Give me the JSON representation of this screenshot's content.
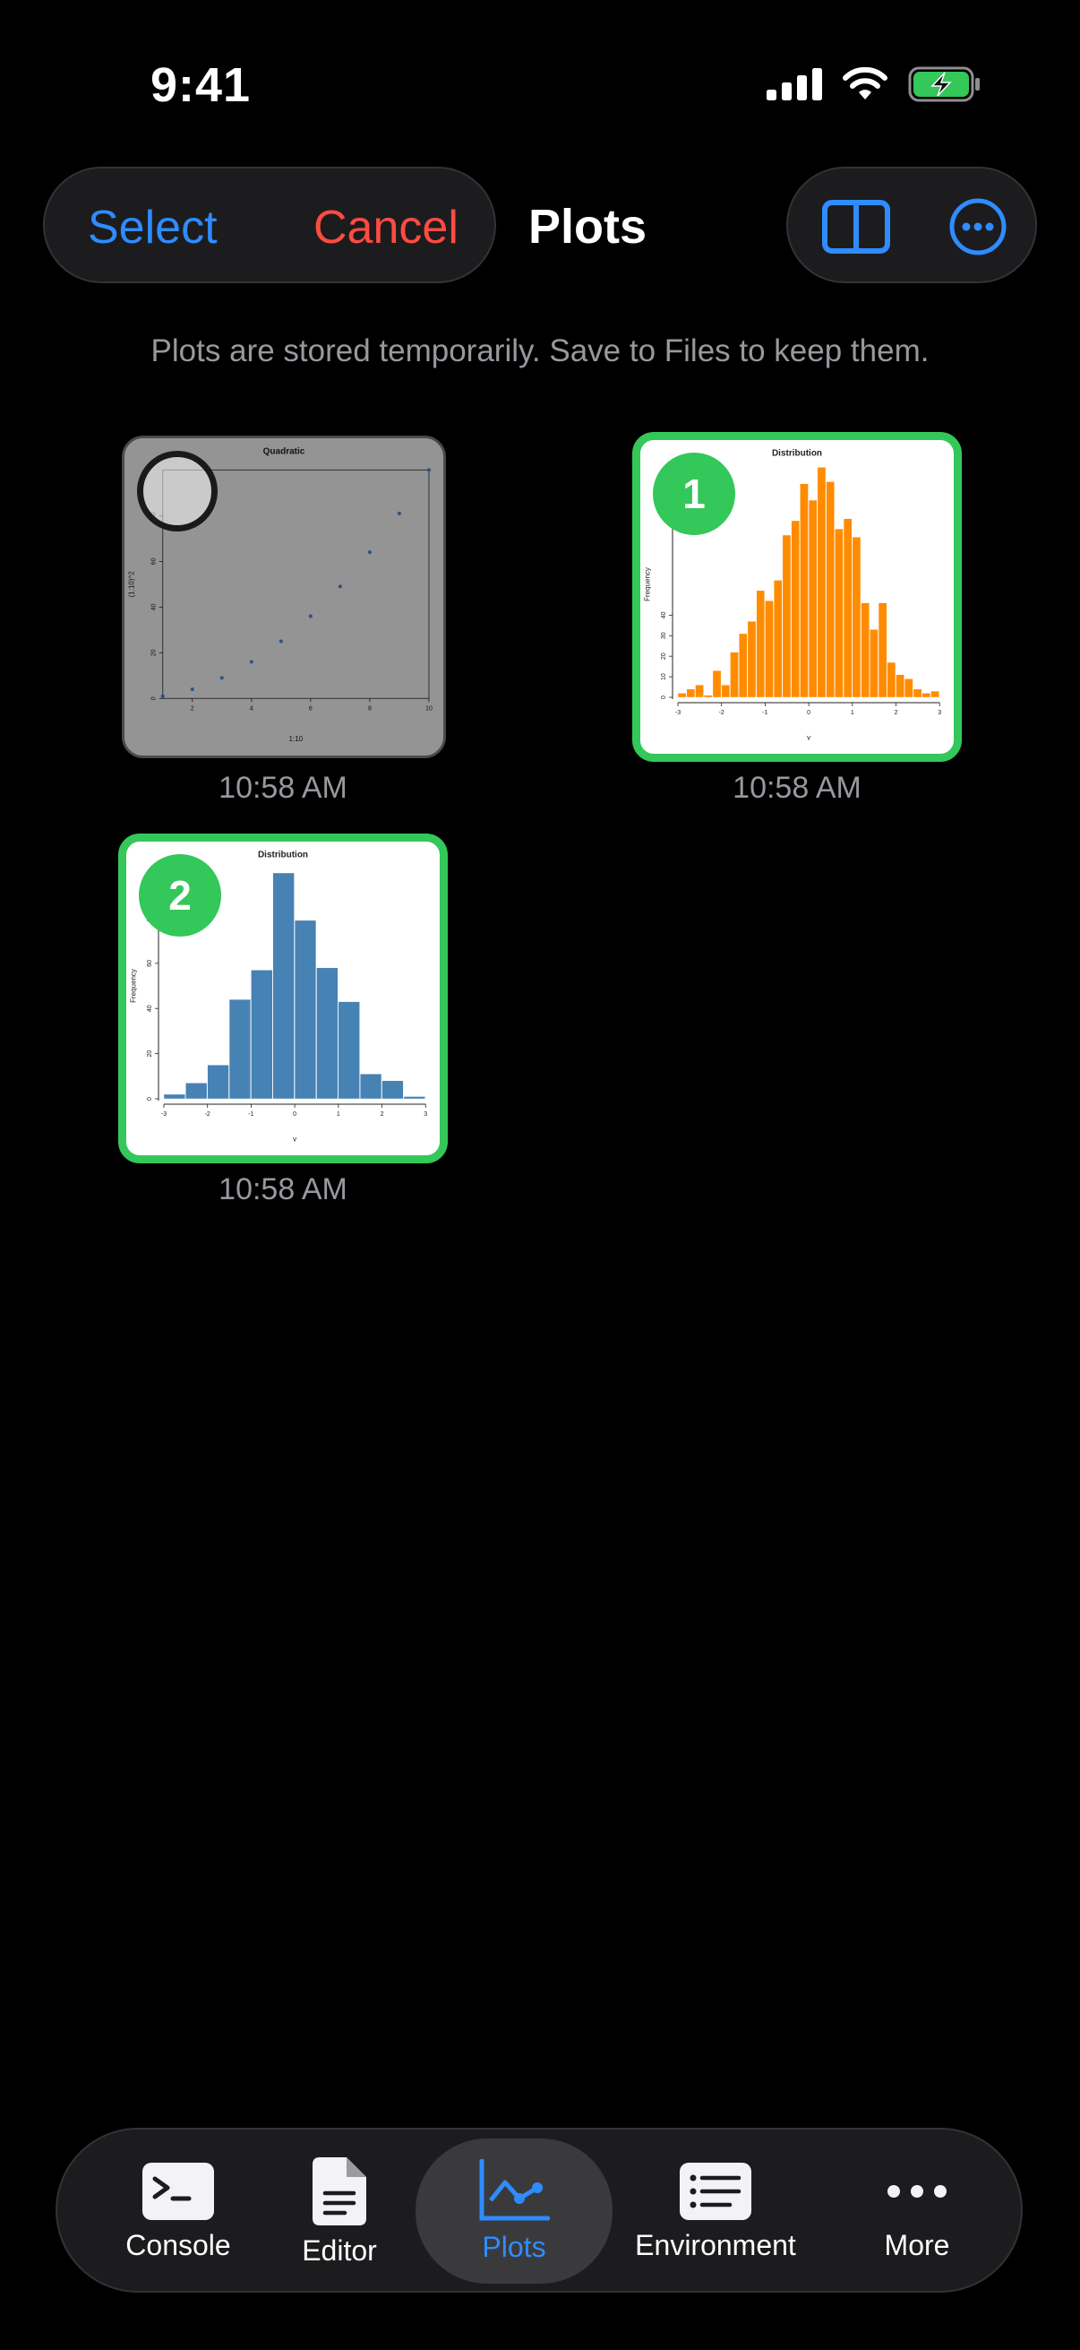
{
  "status_bar": {
    "time": "9:41"
  },
  "header": {
    "select_label": "Select",
    "cancel_label": "Cancel",
    "title": "Plots"
  },
  "notice": "Plots are stored temporarily. Save to Files to keep them.",
  "plots": [
    {
      "selected": false,
      "time": "10:58 AM",
      "chart_data": {
        "type": "scatter",
        "title": "Quadratic",
        "xlabel": "1:10",
        "ylabel": "(1:10)^2",
        "x": [
          1,
          2,
          3,
          4,
          5,
          6,
          7,
          8,
          9,
          10
        ],
        "y": [
          1,
          4,
          9,
          16,
          25,
          36,
          49,
          64,
          81,
          100
        ],
        "x_ticks": [
          "2",
          "4",
          "6",
          "8",
          "10"
        ],
        "y_ticks": [
          "0",
          "20",
          "40",
          "60",
          "80"
        ],
        "xlim": [
          1,
          10
        ],
        "ylim": [
          0,
          100
        ],
        "color": "#4f8fd6"
      }
    },
    {
      "selected": true,
      "badge": "1",
      "time": "10:58 AM",
      "chart_data": {
        "type": "bar",
        "title": "Distribution",
        "xlabel": "v",
        "ylabel": "Frequency",
        "bins_start": -3,
        "bin_width": 0.2,
        "values": [
          2,
          4,
          6,
          1,
          13,
          6,
          22,
          31,
          37,
          52,
          47,
          57,
          79,
          86,
          104,
          96,
          112,
          105,
          82,
          87,
          78,
          46,
          33,
          46,
          17,
          11,
          9,
          4,
          2,
          3
        ],
        "x_ticks": [
          "-3",
          "-2",
          "-1",
          "0",
          "1",
          "2",
          "3"
        ],
        "y_ticks": [
          "0",
          "10",
          "20",
          "30",
          "40"
        ],
        "xlim": [
          -3,
          3
        ],
        "ylim": [
          0,
          110
        ],
        "color": "#ff8c00"
      }
    },
    {
      "selected": true,
      "badge": "2",
      "time": "10:58 AM",
      "chart_data": {
        "type": "bar",
        "title": "Distribution",
        "xlabel": "v",
        "ylabel": "Frequency",
        "bins_start": -3,
        "bin_width": 0.5,
        "values": [
          2,
          7,
          15,
          44,
          57,
          100,
          79,
          58,
          43,
          11,
          8,
          1
        ],
        "x_ticks": [
          "-3",
          "-2",
          "-1",
          "0",
          "1",
          "2",
          "3"
        ],
        "y_ticks": [
          "0",
          "20",
          "40",
          "60",
          "80"
        ],
        "xlim": [
          -3,
          3
        ],
        "ylim": [
          0,
          100
        ],
        "color": "#4682b4"
      }
    }
  ],
  "tab_bar": {
    "tabs": [
      {
        "label": "Console",
        "icon": "terminal-icon",
        "active": false
      },
      {
        "label": "Editor",
        "icon": "document-icon",
        "active": false
      },
      {
        "label": "Plots",
        "icon": "chart-line-icon",
        "active": true
      },
      {
        "label": "Environment",
        "icon": "list-icon",
        "active": false
      },
      {
        "label": "More",
        "icon": "ellipsis-icon",
        "active": false
      }
    ]
  },
  "colors": {
    "accent": "#2f8cff",
    "destructive": "#ff4b42",
    "selection": "#34c759",
    "secondary_text": "#98989e"
  }
}
